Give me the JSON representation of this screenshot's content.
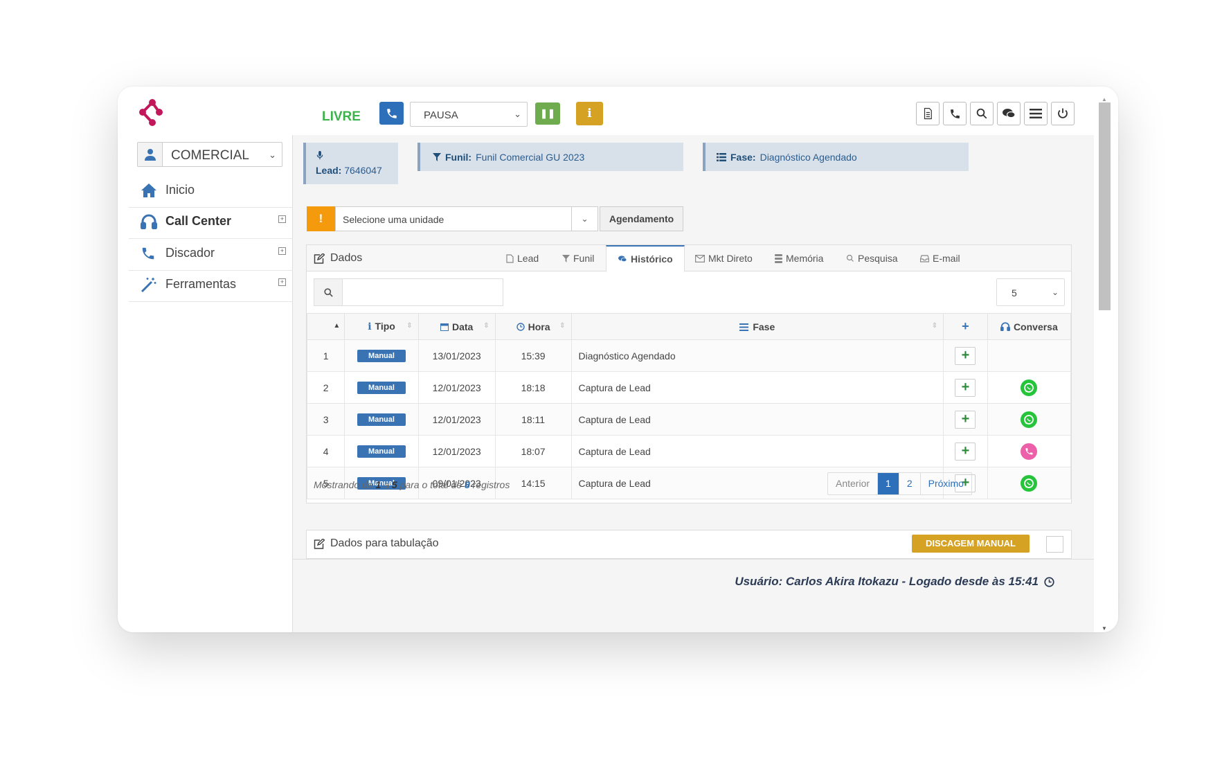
{
  "topbar": {
    "status": "LIVRE",
    "pause_select": "PAUSA",
    "info_label": "i"
  },
  "sidebar": {
    "department": "COMERCIAL",
    "items": [
      {
        "label": "Inicio"
      },
      {
        "label": "Call Center"
      },
      {
        "label": "Discador"
      },
      {
        "label": "Ferramentas"
      }
    ]
  },
  "info": {
    "lead_label": "Lead:",
    "lead_value": "7646047",
    "funil_label": "Funil:",
    "funil_value": "Funil Comercial GU 2023",
    "fase_label": "Fase:",
    "fase_value": "Diagnóstico Agendado"
  },
  "unit": {
    "warn": "!",
    "placeholder": "Selecione uma unidade",
    "button": "Agendamento"
  },
  "panel": {
    "title": "Dados",
    "tabs": [
      "Lead",
      "Funil",
      "Histórico",
      "Mkt Direto",
      "Memória",
      "Pesquisa",
      "E-mail"
    ],
    "per_page": "5"
  },
  "table": {
    "headers": [
      "Tipo",
      "Data",
      "Hora",
      "Fase",
      "Conversa"
    ],
    "rows": [
      {
        "n": "1",
        "tipo": "Manual",
        "data": "13/01/2023",
        "hora": "15:39",
        "fase": "Diagnóstico Agendado",
        "conversa": "none"
      },
      {
        "n": "2",
        "tipo": "Manual",
        "data": "12/01/2023",
        "hora": "18:18",
        "fase": "Captura de Lead",
        "conversa": "whatsapp"
      },
      {
        "n": "3",
        "tipo": "Manual",
        "data": "12/01/2023",
        "hora": "18:11",
        "fase": "Captura de Lead",
        "conversa": "whatsapp"
      },
      {
        "n": "4",
        "tipo": "Manual",
        "data": "12/01/2023",
        "hora": "18:07",
        "fase": "Captura de Lead",
        "conversa": "call"
      },
      {
        "n": "5",
        "tipo": "Manual",
        "data": "09/01/2023",
        "hora": "14:15",
        "fase": "Captura de Lead",
        "conversa": "whatsapp"
      }
    ]
  },
  "footer_info": {
    "p1": "Mostrando de",
    "from": "1",
    "p2": "a",
    "to": "5",
    "p3": "para o total de",
    "total": "8",
    "p4": "registros"
  },
  "pager": {
    "prev": "Anterior",
    "pages": [
      "1",
      "2"
    ],
    "next": "Próximo"
  },
  "tabulacao": {
    "title": "Dados para tabulação",
    "button": "DISCAGEM MANUAL"
  },
  "status": {
    "user": "Usuário: Carlos Akira Itokazu - Logado desde às 15:41"
  },
  "colors": {
    "brand": "#c2185b",
    "primary": "#2d6fb8",
    "success": "#3cb34a",
    "warning": "#d5a224",
    "whatsapp": "#25c43a",
    "call": "#ec5fa9"
  }
}
